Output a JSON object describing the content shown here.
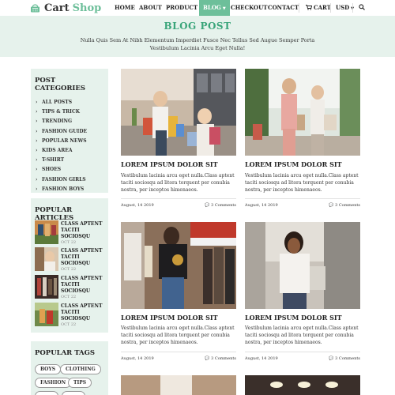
{
  "brand": {
    "word1": "Cart",
    "word2": "Shop",
    "accent": "#6dbf9a",
    "bg_tint": "#e6f2ec"
  },
  "nav": {
    "home": "HOME",
    "about": "ABOUT",
    "product": "PRODUCT",
    "blog": "BLOG",
    "checkout": "CHECKOUT",
    "contact": "CONTACT",
    "cart": "CART",
    "currency": "USD"
  },
  "hero": {
    "title": "BLOG POST",
    "subtitle": "Nulla Quis Sem At Nibh Elementum Imperdiet Fusce Nec Tellus Sed Augue Semper Porta Vestibulum Lacinia Arcu Eget Nulla!"
  },
  "sidebar": {
    "categories_title": "POST CATEGORIES",
    "categories": [
      "ALL POSTS",
      "TIPS & TRICK",
      "TRENDING",
      "FASHION GUIDE",
      "POPULAR NEWS",
      "KIDS AREA",
      "T-SHIRT",
      "SHOES",
      "FASHION GIRLS",
      "FASHION BOYS"
    ],
    "articles_title": "POPULAR ARTICLES",
    "articles": [
      {
        "title": "CLASS APTENT TACITI SOCIOSQU",
        "date": "OCT 22"
      },
      {
        "title": "CLASS APTENT TACITI SOCIOSQU",
        "date": "OCT 22"
      },
      {
        "title": "CLASS APTENT TACITI SOCIOSQU",
        "date": "OCT 22"
      },
      {
        "title": "CLASS APTENT TACITI SOCIOSQU",
        "date": "OCT 22"
      }
    ],
    "tags_title": "POPULAR TAGS",
    "tags": [
      "BOYS",
      "CLOTHING",
      "FASHION",
      "TIPS"
    ]
  },
  "posts": [
    {
      "title": "LOREM IPSUM DOLOR SIT",
      "text": "Vestibulum lacinia arcu eget nulla.Class aptent taciti sociosqu ad litora torquent per conubia nostra, per inceptos himenaeos.",
      "date": "August, 14 2019",
      "comments": "3 Comments"
    },
    {
      "title": "LOREM IPSUM DOLOR SIT",
      "text": "Vestibulum lacinia arcu eget nulla.Class aptent taciti sociosqu ad litora torquent per conubia nostra, per inceptos himenaeos.",
      "date": "August, 14 2019",
      "comments": "3 Comments"
    },
    {
      "title": "LOREM IPSUM DOLOR SIT",
      "text": "Vestibulum lacinia arcu eget nulla.Class aptent taciti sociosqu ad litora torquent per conubia nostra, per inceptos himenaeos.",
      "date": "August, 14 2019",
      "comments": "3 Comments"
    },
    {
      "title": "LOREM IPSUM DOLOR SIT",
      "text": "Vestibulum lacinia arcu eget nulla.Class aptent taciti sociosqu ad litora torquent per conubia nostra, per inceptos himenaeos.",
      "date": "August, 14 2019",
      "comments": "3 Comments"
    }
  ]
}
